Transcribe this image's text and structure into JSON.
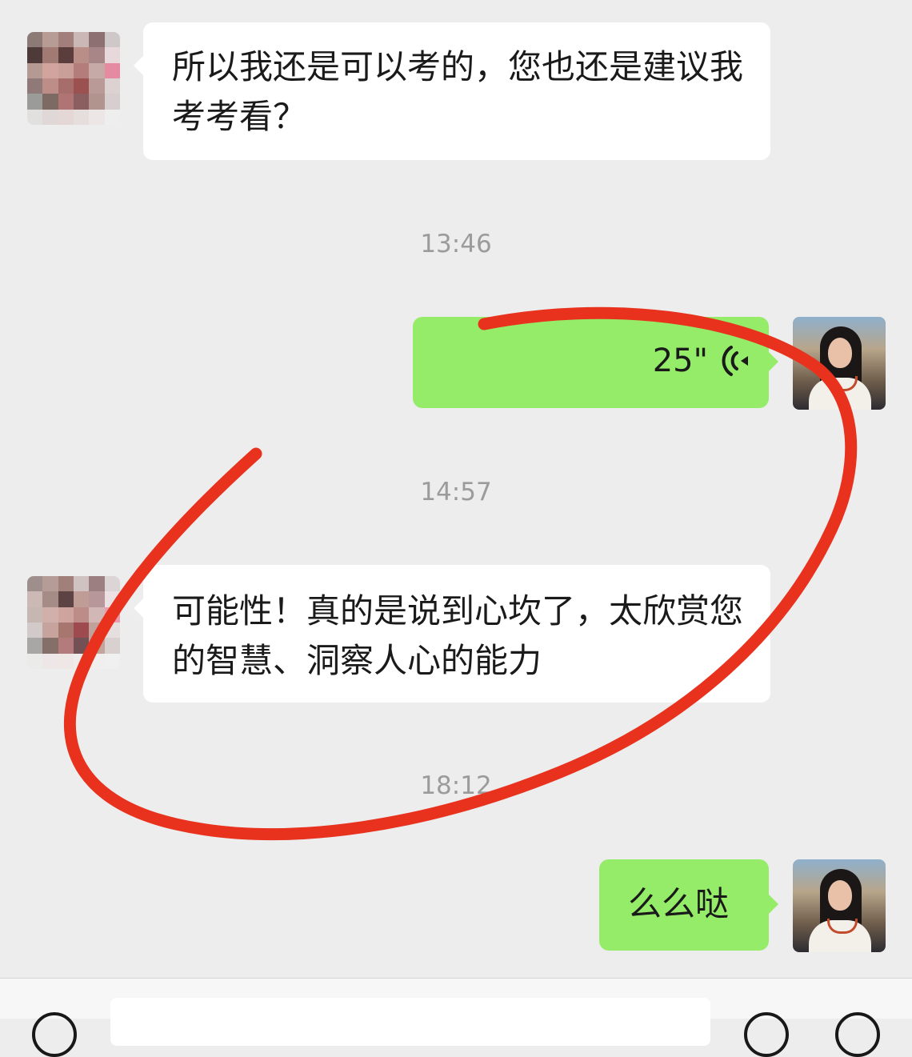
{
  "messages": [
    {
      "text": "所以我还是可以考的，您也还是建议我考考看？"
    },
    {
      "voice_duration": "25\""
    },
    {
      "text": "可能性！真的是说到心坎了，太欣赏您的智慧、洞察人心的能力"
    },
    {
      "text": "么么哒"
    }
  ],
  "timestamps": [
    "13:46",
    "14:57",
    "18:12"
  ],
  "icons": {
    "voice": "voice-wave-icon",
    "input_left": "voice-input-icon",
    "input_emoji": "emoji-icon",
    "input_add": "add-icon"
  },
  "colors": {
    "background": "#ededed",
    "incoming_bubble": "#ffffff",
    "outgoing_bubble": "#95ec69",
    "annotation": "#e8321e",
    "timestamp": "#9b9b9b"
  }
}
